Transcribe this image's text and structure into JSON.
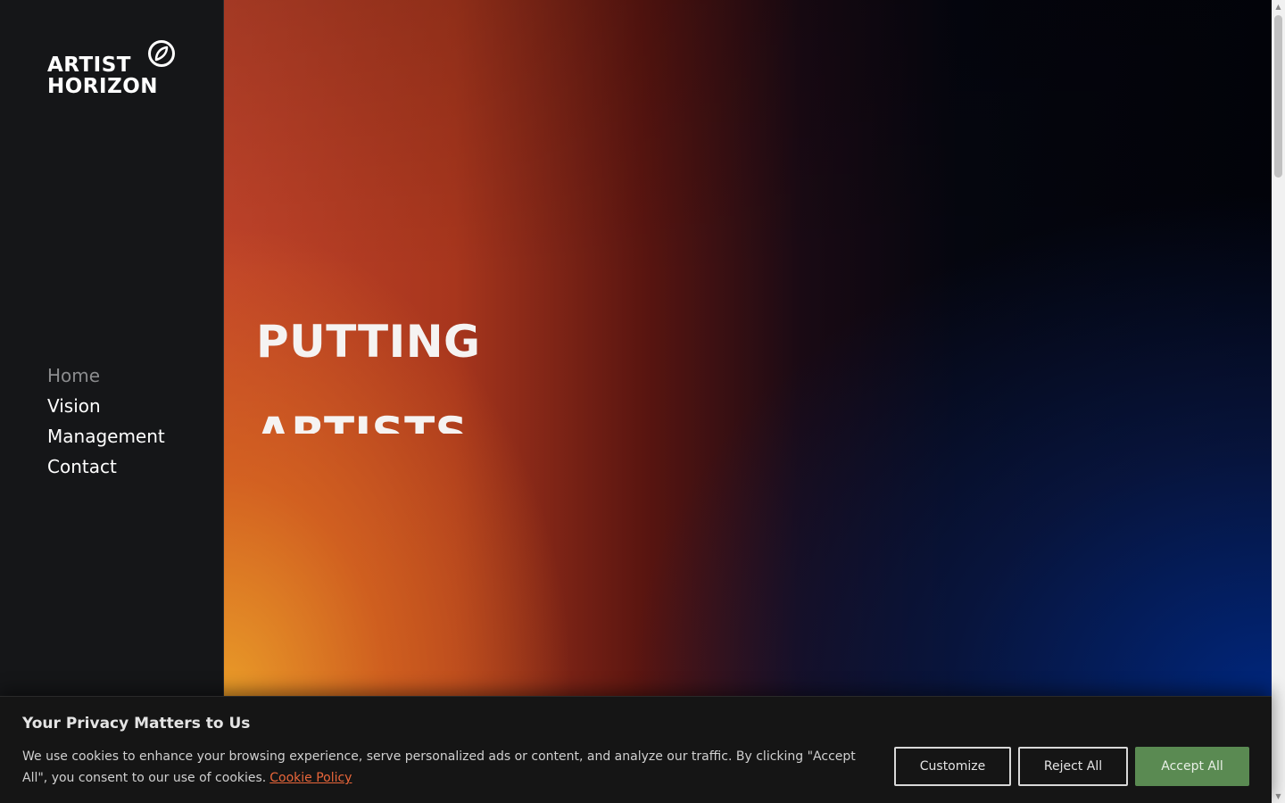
{
  "logo": {
    "line1": "ARTIST",
    "line2": "HORIZON",
    "mark_icon": "leaf-circle-icon"
  },
  "nav": {
    "items": [
      {
        "label": "Home",
        "active": true
      },
      {
        "label": "Vision",
        "active": false
      },
      {
        "label": "Management",
        "active": false
      },
      {
        "label": "Contact",
        "active": false
      }
    ]
  },
  "hero": {
    "headline_line1": "PUTTING",
    "headline_line2": "ARTISTS"
  },
  "cookie": {
    "title": "Your Privacy Matters to Us",
    "text": "We use cookies to enhance your browsing experience, serve personalized ads or content, and analyze our traffic. By clicking \"Accept All\", you consent to our use of cookies.",
    "link_label": "Cookie Policy",
    "customize_label": "Customize",
    "reject_label": "Reject All",
    "accept_label": "Accept All"
  },
  "colors": {
    "sidebar_bg": "#151618",
    "accent_link": "#e9663a",
    "accept_button": "#5a8a52"
  }
}
